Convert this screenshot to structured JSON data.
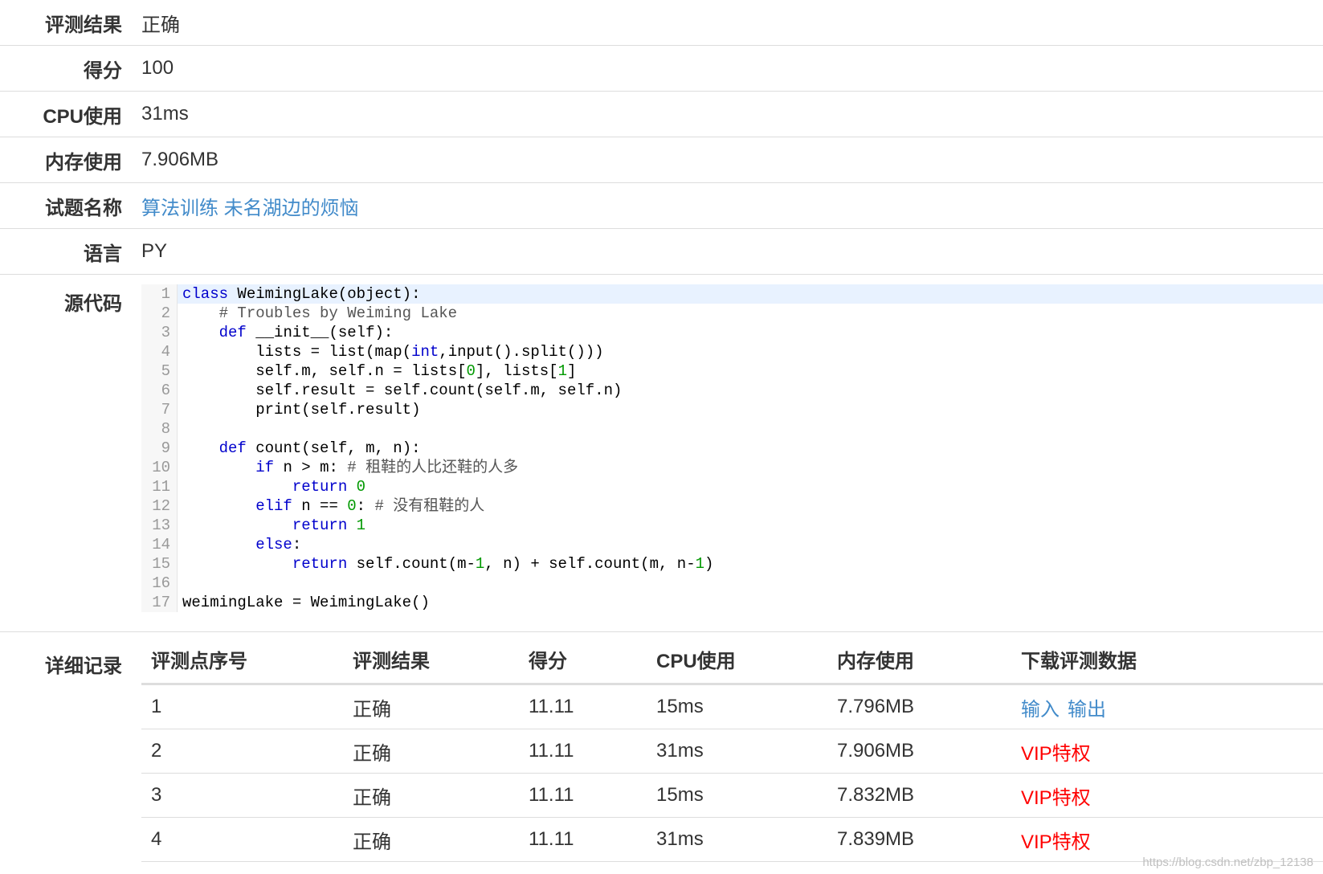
{
  "info": {
    "result_label": "评测结果",
    "result_value": "正确",
    "score_label": "得分",
    "score_value": "100",
    "cpu_label": "CPU使用",
    "cpu_value": "31ms",
    "mem_label": "内存使用",
    "mem_value": "7.906MB",
    "problem_label": "试题名称",
    "problem_value": "算法训练 未名湖边的烦恼",
    "lang_label": "语言",
    "lang_value": "PY",
    "source_label": "源代码",
    "detail_label": "详细记录"
  },
  "code_lines": [
    "class WeimingLake(object):",
    "    # Troubles by Weiming Lake",
    "    def __init__(self):",
    "        lists = list(map(int,input().split()))",
    "        self.m, self.n = lists[0], lists[1]",
    "        self.result = self.count(self.m, self.n)",
    "        print(self.result)",
    "",
    "    def count(self, m, n):",
    "        if n > m: # 租鞋的人比还鞋的人多",
    "            return 0",
    "        elif n == 0: # 没有租鞋的人",
    "            return 1",
    "        else:",
    "            return self.count(m-1, n) + self.count(m, n-1)",
    "",
    "weimingLake = WeimingLake()"
  ],
  "table": {
    "headers": [
      "评测点序号",
      "评测结果",
      "得分",
      "CPU使用",
      "内存使用",
      "下载评测数据"
    ],
    "rows": [
      {
        "idx": "1",
        "result": "正确",
        "score": "11.11",
        "cpu": "15ms",
        "mem": "7.796MB",
        "download": [
          "输入",
          "输出"
        ],
        "vip": ""
      },
      {
        "idx": "2",
        "result": "正确",
        "score": "11.11",
        "cpu": "31ms",
        "mem": "7.906MB",
        "download": [],
        "vip": "VIP特权"
      },
      {
        "idx": "3",
        "result": "正确",
        "score": "11.11",
        "cpu": "15ms",
        "mem": "7.832MB",
        "download": [],
        "vip": "VIP特权"
      },
      {
        "idx": "4",
        "result": "正确",
        "score": "11.11",
        "cpu": "31ms",
        "mem": "7.839MB",
        "download": [],
        "vip": "VIP特权"
      }
    ]
  },
  "watermark": "https://blog.csdn.net/zbp_12138",
  "colors": {
    "link": "#428bca",
    "vip": "#ff0000",
    "keyword": "#0000cc",
    "number": "#009900"
  }
}
